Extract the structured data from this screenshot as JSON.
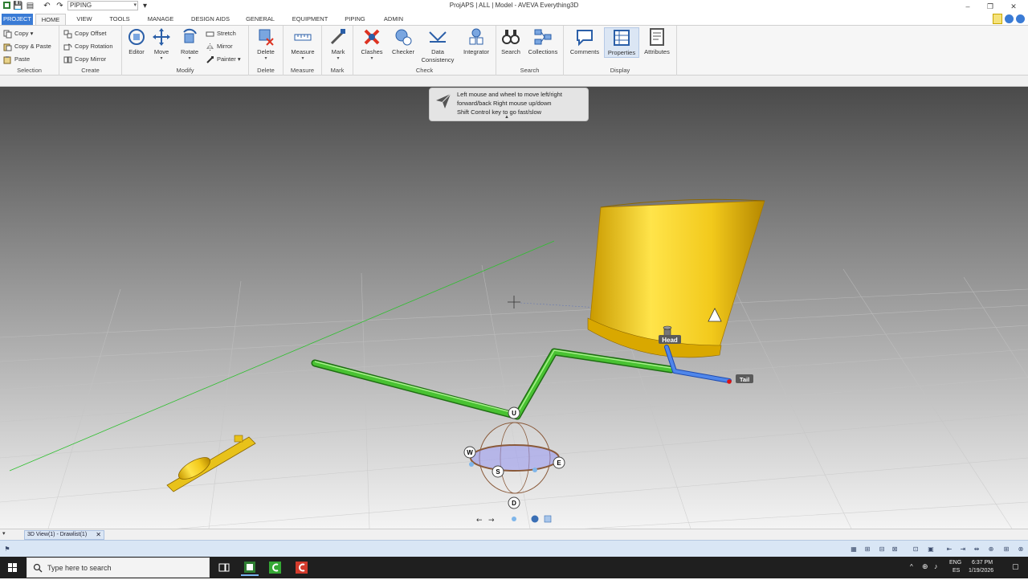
{
  "window": {
    "title": "ProjAPS | ALL | Model - AVEVA Everything3D",
    "workspace": "PIPING"
  },
  "tabs": [
    "PROJECT",
    "HOME",
    "VIEW",
    "TOOLS",
    "MANAGE",
    "DESIGN AIDS",
    "GENERAL",
    "EQUIPMENT",
    "PIPING",
    "ADMIN"
  ],
  "ribbon": {
    "selection": {
      "label": "Selection",
      "copy": "Copy",
      "copy_paste": "Copy & Paste",
      "paste": "Paste"
    },
    "create": {
      "label": "Create",
      "copy_offset": "Copy Offset",
      "copy_rotation": "Copy Rotation",
      "copy_mirror": "Copy Mirror"
    },
    "modify": {
      "label": "Modify",
      "editor": "Editor",
      "move": "Move",
      "rotate": "Rotate",
      "stretch": "Stretch",
      "mirror": "Mirror",
      "painter": "Painter"
    },
    "delete": {
      "label": "Delete",
      "delete": "Delete"
    },
    "measure": {
      "label": "Measure",
      "measure": "Measure"
    },
    "mark": {
      "label": "Mark",
      "mark": "Mark"
    },
    "check": {
      "label": "Check",
      "clashes": "Clashes",
      "checker": "Checker",
      "data_consistency_1": "Data",
      "data_consistency_2": "Consistency",
      "integrator": "Integrator"
    },
    "search": {
      "label": "Search",
      "search": "Search",
      "collections": "Collections"
    },
    "display": {
      "label": "Display",
      "comments": "Comments",
      "properties": "Properties",
      "attributes": "Attributes"
    }
  },
  "tooltip": {
    "line1": "Left mouse and wheel to move left/right",
    "line2": "forward/back Right mouse up/down",
    "line3": "Shift  Control key to go fast/slow"
  },
  "scene": {
    "head_label": "Head",
    "tail_label": "Tail",
    "gizmo": {
      "u": "U",
      "d": "D",
      "w": "W",
      "e": "E",
      "s": "S"
    },
    "colors": {
      "pipe": "#3fb52a",
      "branch": "#3b6fd9",
      "vessel": "#e8c21a"
    }
  },
  "doc_tab": "3D View(1) - Drawlist(1)",
  "taskbar": {
    "search_placeholder": "Type here to search",
    "lang": "ENG",
    "locale": "ES",
    "time": "6:37 PM",
    "date": "1/19/2026"
  }
}
